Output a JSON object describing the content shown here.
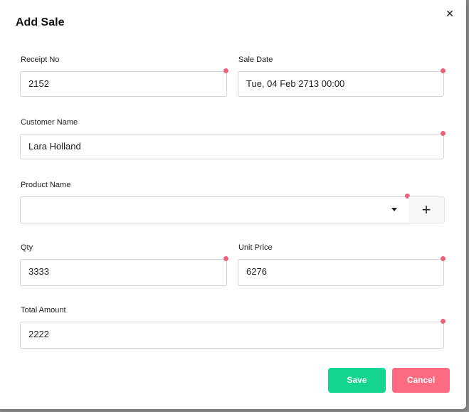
{
  "dialog": {
    "title": "Add Sale",
    "close_glyph": "✕"
  },
  "fields": {
    "receipt_no": {
      "label": "Receipt No",
      "value": "2152"
    },
    "sale_date": {
      "label": "Sale Date",
      "value": "Tue, 04 Feb 2713 00:00"
    },
    "customer_name": {
      "label": "Customer Name",
      "value": "Lara Holland"
    },
    "product_name": {
      "label": "Product Name",
      "value": ""
    },
    "qty": {
      "label": "Qty",
      "value": "3333"
    },
    "unit_price": {
      "label": "Unit Price",
      "value": "6276"
    },
    "total_amount": {
      "label": "Total Amount",
      "value": "2222"
    }
  },
  "add_product_glyph": "+",
  "buttons": {
    "save": "Save",
    "cancel": "Cancel"
  },
  "colors": {
    "required_marker": "#f0647a",
    "save": "#14d590",
    "cancel": "#ff6b81"
  },
  "icons": {
    "close": "close-icon",
    "dropdown": "chevron-down-icon",
    "add": "plus-icon"
  }
}
